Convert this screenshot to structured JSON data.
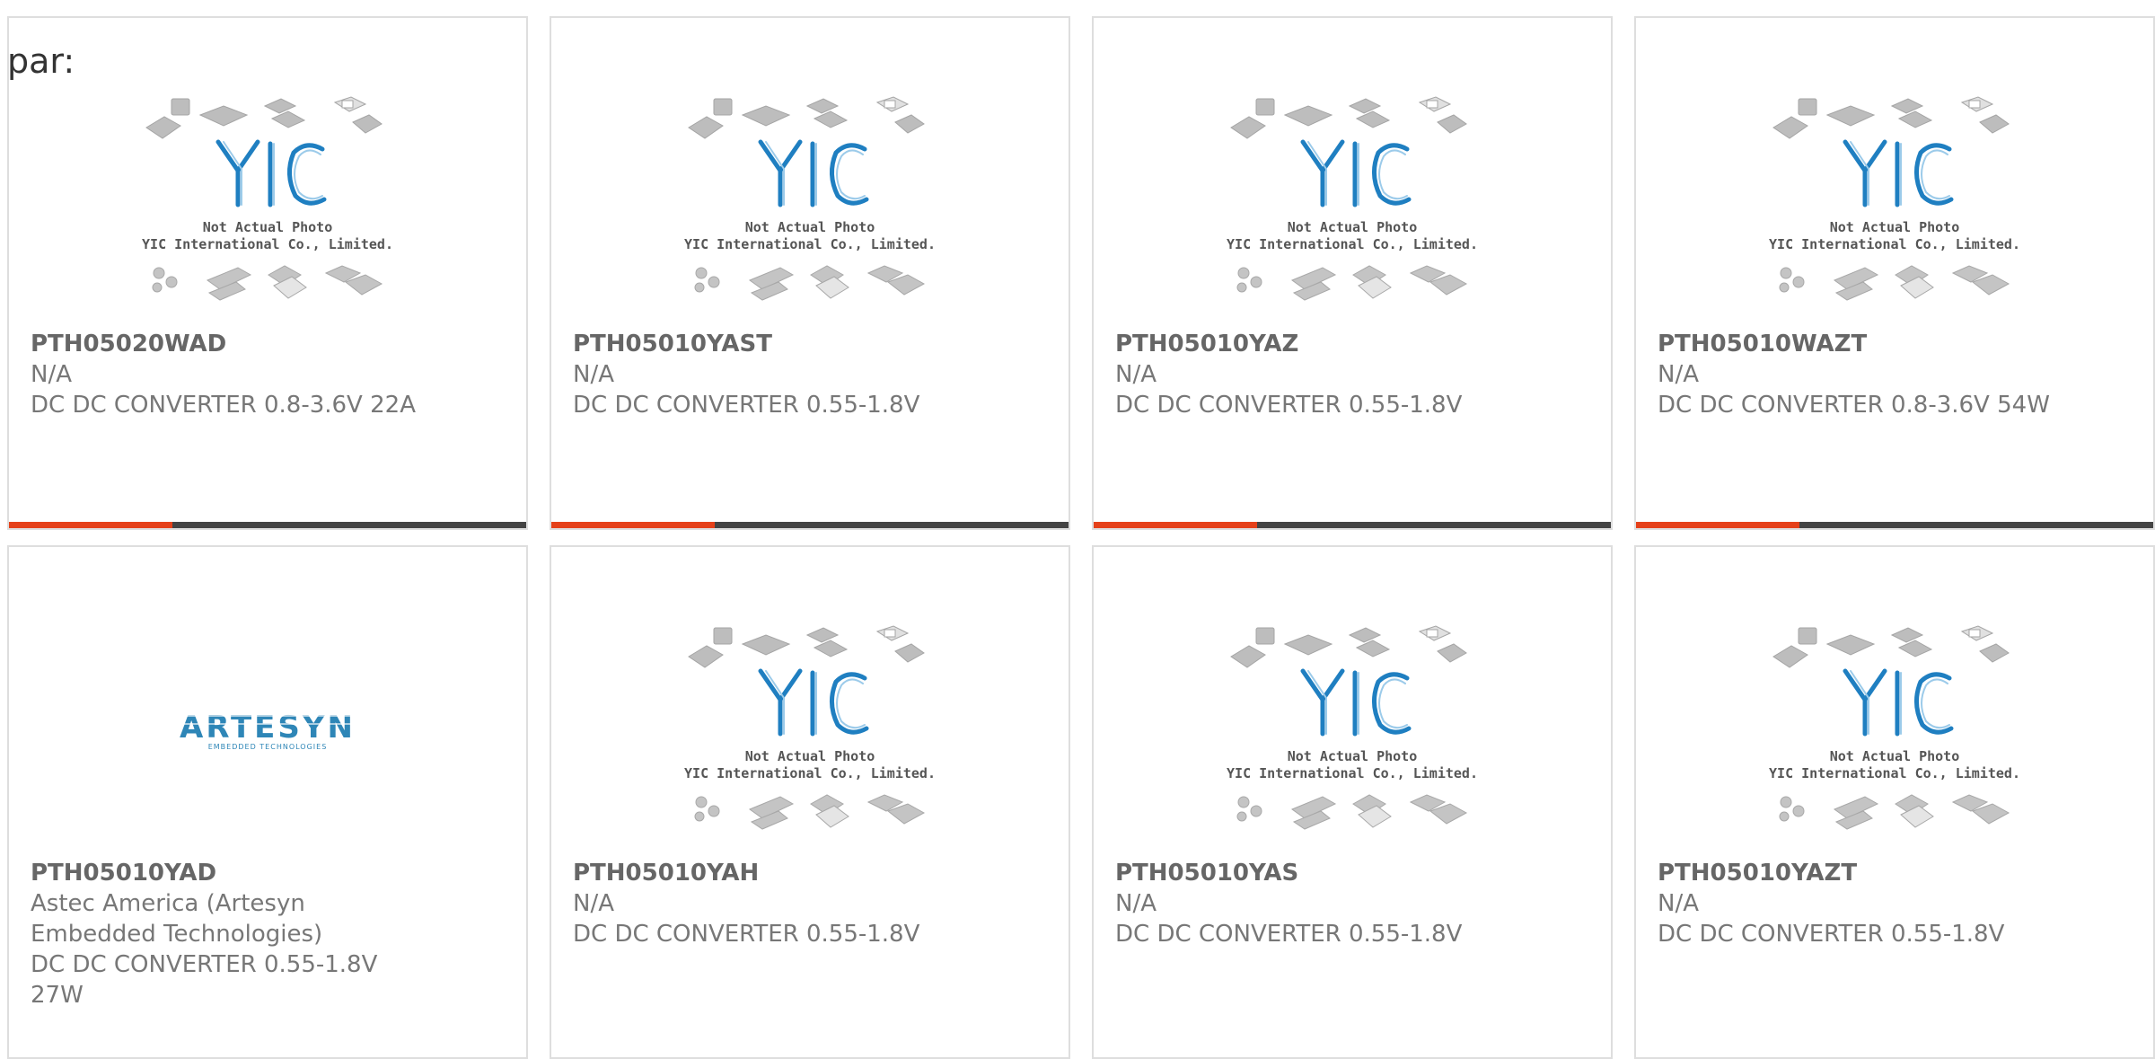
{
  "prefix_text": "par:",
  "colors": {
    "accent": "#e5411a",
    "bar_dark": "#444444",
    "yic_blue": "#1f7fc1"
  },
  "placeholder_photo": {
    "line1": "Not Actual Photo",
    "line2": "YIC International Co., Limited."
  },
  "artesyn_logo": {
    "name": "ARTESYN",
    "tagline": "EMBEDDED TECHNOLOGIES"
  },
  "products": [
    {
      "part": "PTH05020WAD",
      "maker": "N/A",
      "desc": "DC DC CONVERTER 0.8-3.6V 22A",
      "image": "yic-placeholder"
    },
    {
      "part": "PTH05010YAST",
      "maker": "N/A",
      "desc": "DC DC CONVERTER 0.55-1.8V",
      "image": "yic-placeholder"
    },
    {
      "part": "PTH05010YAZ",
      "maker": "N/A",
      "desc": "DC DC CONVERTER 0.55-1.8V",
      "image": "yic-placeholder"
    },
    {
      "part": "PTH05010WAZT",
      "maker": "N/A",
      "desc": "DC DC CONVERTER 0.8-3.6V 54W",
      "image": "yic-placeholder"
    },
    {
      "part": "PTH05010YAD",
      "maker": "Astec America (Artesyn Embedded Technologies)",
      "desc": "DC DC CONVERTER 0.55-1.8V 27W",
      "image": "artesyn-logo"
    },
    {
      "part": "PTH05010YAH",
      "maker": "N/A",
      "desc": "DC DC CONVERTER 0.55-1.8V",
      "image": "yic-placeholder"
    },
    {
      "part": "PTH05010YAS",
      "maker": "N/A",
      "desc": "DC DC CONVERTER 0.55-1.8V",
      "image": "yic-placeholder"
    },
    {
      "part": "PTH05010YAZT",
      "maker": "N/A",
      "desc": "DC DC CONVERTER 0.55-1.8V",
      "image": "yic-placeholder"
    }
  ]
}
